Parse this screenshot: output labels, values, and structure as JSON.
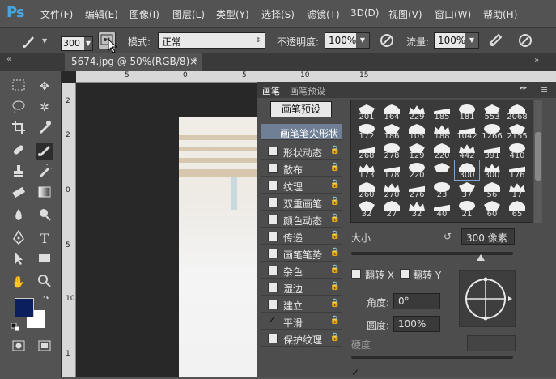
{
  "app": {
    "logo": "Ps"
  },
  "menu": {
    "items": [
      "文件(F)",
      "编辑(E)",
      "图像(I)",
      "图层(L)",
      "类型(Y)",
      "选择(S)",
      "滤镜(T)",
      "3D(D)",
      "视图(V)",
      "窗口(W)",
      "帮助(H)"
    ]
  },
  "options": {
    "brush_size": "300",
    "mode_label": "模式:",
    "mode_value": "正常",
    "opacity_label": "不透明度:",
    "opacity_value": "100%",
    "flow_label": "流量:",
    "flow_value": "100%"
  },
  "document": {
    "tab_title": "5674.jpg @ 50%(RGB/8) *",
    "close": "×"
  },
  "rulers": {
    "top": [
      "5",
      "0",
      "5",
      "10",
      "15"
    ],
    "left": [
      "2",
      "2",
      "0",
      "5",
      "10",
      "1"
    ]
  },
  "panel": {
    "tabs": [
      "画笔",
      "画笔预设"
    ],
    "preset_button": "画笔预设",
    "options": [
      {
        "label": "画笔笔尖形状",
        "checked": false,
        "selected": true,
        "has_checkbox": false
      },
      {
        "label": "形状动态",
        "checked": false,
        "selected": false,
        "has_checkbox": true
      },
      {
        "label": "散布",
        "checked": false,
        "selected": false,
        "has_checkbox": true
      },
      {
        "label": "纹理",
        "checked": false,
        "selected": false,
        "has_checkbox": true
      },
      {
        "label": "双重画笔",
        "checked": false,
        "selected": false,
        "has_checkbox": true
      },
      {
        "label": "颜色动态",
        "checked": false,
        "selected": false,
        "has_checkbox": true
      },
      {
        "label": "传递",
        "checked": false,
        "selected": false,
        "has_checkbox": true
      },
      {
        "label": "画笔笔势",
        "checked": false,
        "selected": false,
        "has_checkbox": true
      },
      {
        "label": "杂色",
        "checked": false,
        "selected": false,
        "has_checkbox": true
      },
      {
        "label": "湿边",
        "checked": false,
        "selected": false,
        "has_checkbox": true
      },
      {
        "label": "建立",
        "checked": false,
        "selected": false,
        "has_checkbox": true
      },
      {
        "label": "平滑",
        "checked": true,
        "selected": false,
        "has_checkbox": true
      },
      {
        "label": "保护纹理",
        "checked": false,
        "selected": false,
        "has_checkbox": true
      }
    ],
    "brushes": [
      "201",
      "164",
      "229",
      "185",
      "181",
      "553",
      "2068",
      "172",
      "186",
      "105",
      "188",
      "1042",
      "1266",
      "2155",
      "268",
      "278",
      "129",
      "220",
      "442",
      "391",
      "410",
      "173",
      "178",
      "220",
      "",
      "300",
      "300",
      "176",
      "260",
      "270",
      "276",
      "23",
      "37",
      "56",
      "17",
      "32",
      "27",
      "32",
      "40",
      "21",
      "60",
      "65"
    ],
    "selected_brush": "300",
    "size_label": "大小",
    "size_value": "300 像素",
    "flip_x": "翻转 X",
    "flip_y": "翻转 Y",
    "angle_label": "角度:",
    "angle_value": "0°",
    "roundness_label": "圆度:",
    "roundness_value": "100%",
    "hardness_label": "硬度"
  }
}
